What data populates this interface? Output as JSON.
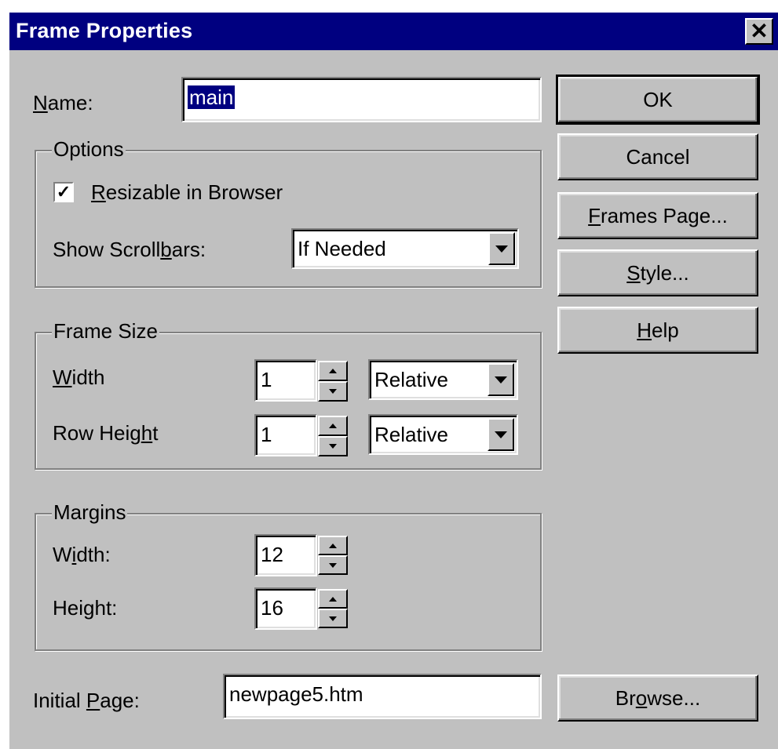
{
  "window": {
    "title": "Frame Properties",
    "close_icon": "close-icon"
  },
  "name_field": {
    "label": "Name:",
    "value": "main"
  },
  "options": {
    "title": "Options",
    "resizable": {
      "label": "Resizable in Browser",
      "checked": true
    },
    "scrollbars": {
      "label": "Show Scrollbars:",
      "value": "If Needed"
    }
  },
  "frame_size": {
    "title": "Frame Size",
    "width": {
      "label": "Width",
      "value": "1",
      "unit": "Relative"
    },
    "row_height": {
      "label": "Row Height",
      "value": "1",
      "unit": "Relative"
    }
  },
  "margins": {
    "title": "Margins",
    "width": {
      "label": "Width:",
      "value": "12"
    },
    "height": {
      "label": "Height:",
      "value": "16"
    }
  },
  "initial_page": {
    "label": "Initial Page:",
    "value": "newpage5.htm"
  },
  "buttons": {
    "ok": "OK",
    "cancel": "Cancel",
    "frames_page": "Frames Page...",
    "style": "Style...",
    "help": "Help",
    "browse": "Browse..."
  }
}
